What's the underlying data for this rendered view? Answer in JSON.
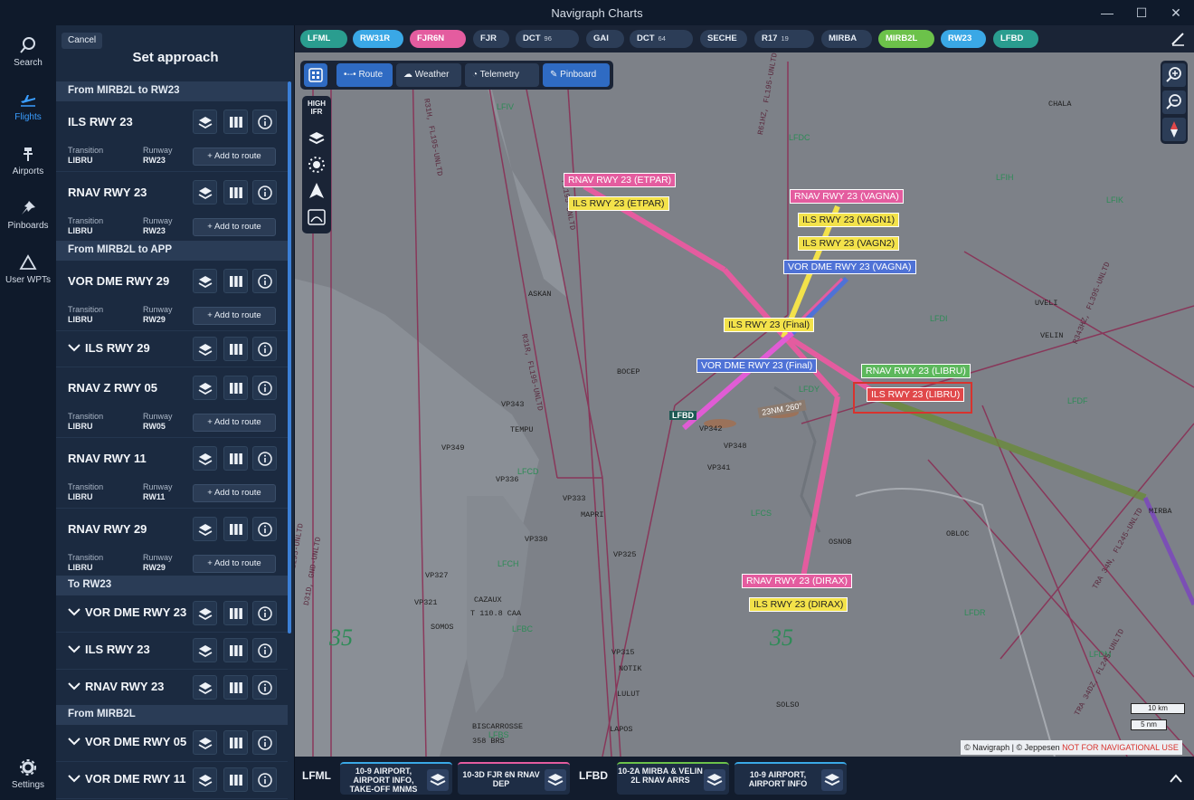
{
  "window": {
    "title": "Navigraph Charts",
    "minimize": "—",
    "maximize": "☐",
    "close": "✕"
  },
  "rail": {
    "items": [
      {
        "label": "Search",
        "icon": "search-icon"
      },
      {
        "label": "Flights",
        "icon": "plane-icon",
        "active": true
      },
      {
        "label": "Airports",
        "icon": "tower-icon"
      },
      {
        "label": "Pinboards",
        "icon": "pin-icon"
      },
      {
        "label": "User WPTs",
        "icon": "triangle-icon"
      }
    ],
    "settings": "Settings"
  },
  "panel": {
    "cancel": "Cancel",
    "title": "Set approach",
    "transition_label": "Transition",
    "runway_label": "Runway",
    "add_label": "+ Add to route",
    "sections": [
      {
        "title": "From MIRB2L to RW23"
      },
      {
        "title": "From MIRB2L to APP"
      },
      {
        "title": "To RW23"
      },
      {
        "title": "From MIRB2L"
      }
    ],
    "rows": [
      {
        "name": "ILS RWY 23",
        "transition": "LIBRU",
        "runway": "RW23"
      },
      {
        "name": "RNAV RWY 23",
        "transition": "LIBRU",
        "runway": "RW23"
      },
      {
        "name": "VOR DME RWY 29",
        "transition": "LIBRU",
        "runway": "RW29"
      },
      {
        "name": "ILS RWY 29"
      },
      {
        "name": "RNAV Z RWY 05",
        "transition": "LIBRU",
        "runway": "RW05"
      },
      {
        "name": "RNAV RWY 11",
        "transition": "LIBRU",
        "runway": "RW11"
      },
      {
        "name": "RNAV RWY 29",
        "transition": "LIBRU",
        "runway": "RW29"
      },
      {
        "name": "VOR DME RWY 23"
      },
      {
        "name": "ILS RWY 23"
      },
      {
        "name": "RNAV RWY 23"
      },
      {
        "name": "VOR DME RWY 05"
      },
      {
        "name": "VOR DME RWY 11"
      }
    ]
  },
  "route_chips": [
    {
      "label": "LFML",
      "bg": "#2a9d8f",
      "fg": "#ffffff"
    },
    {
      "label": "RW31R",
      "bg": "#3aa8e6",
      "fg": "#ffffff"
    },
    {
      "label": "FJR6N",
      "bg": "#e45c9f",
      "fg": "#ffffff"
    },
    {
      "label": "FJR",
      "bg": "#2c3d57",
      "fg": "#e8eef6"
    },
    {
      "label": "DCT",
      "num": "96",
      "bg": "#2c3d57",
      "fg": "#e8eef6"
    },
    {
      "label": "GAI",
      "bg": "#2c3d57",
      "fg": "#e8eef6"
    },
    {
      "label": "DCT",
      "num": "64",
      "bg": "#2c3d57",
      "fg": "#e8eef6"
    },
    {
      "label": "SECHE",
      "bg": "#2c3d57",
      "fg": "#e8eef6"
    },
    {
      "label": "R17",
      "num": "19",
      "bg": "#2c3d57",
      "fg": "#e8eef6"
    },
    {
      "label": "MIRBA",
      "bg": "#2c3d57",
      "fg": "#e8eef6"
    },
    {
      "label": "MIRB2L",
      "bg": "#6cc24a",
      "fg": "#ffffff"
    },
    {
      "label": "RW23",
      "bg": "#3aa8e6",
      "fg": "#ffffff"
    },
    {
      "label": "LFBD",
      "bg": "#2a9d8f",
      "fg": "#ffffff"
    }
  ],
  "toolbar": {
    "route": "Route",
    "weather": "Weather",
    "telemetry": "Telemetry",
    "pinboard": "Pinboard"
  },
  "vtools": {
    "high_ifr": "HIGH IFR"
  },
  "map": {
    "procedure_labels": [
      {
        "text": "RNAV RWY 23 (ETPAR)",
        "bg": "#e45c9f",
        "fg": "#ffffff"
      },
      {
        "text": "ILS RWY 23 (ETPAR)",
        "bg": "#f3e24a",
        "fg": "#222222"
      },
      {
        "text": "RNAV RWY 23 (VAGNA)",
        "bg": "#e45c9f",
        "fg": "#ffffff"
      },
      {
        "text": "ILS RWY 23 (VAGN1)",
        "bg": "#f3e24a",
        "fg": "#222222"
      },
      {
        "text": "ILS RWY 23 (VAGN2)",
        "bg": "#f3e24a",
        "fg": "#222222"
      },
      {
        "text": "VOR DME RWY 23 (VAGNA)",
        "bg": "#4f72d6",
        "fg": "#ffffff"
      },
      {
        "text": "ILS RWY 23 (Final)",
        "bg": "#f3e24a",
        "fg": "#222222"
      },
      {
        "text": "VOR DME RWY 23 (Final)",
        "bg": "#4f72d6",
        "fg": "#ffffff"
      },
      {
        "text": "RNAV RWY 23 (LIBRU)",
        "bg": "#5cb85c",
        "fg": "#ffffff"
      },
      {
        "text": "ILS RWY 23 (LIBRU)",
        "bg": "#e0484a",
        "fg": "#ffffff"
      },
      {
        "text": "RNAV RWY 23 (DIRAX)",
        "bg": "#e45c9f",
        "fg": "#ffffff"
      },
      {
        "text": "ILS RWY 23 (DIRAX)",
        "bg": "#f3e24a",
        "fg": "#222222"
      }
    ],
    "waypoints": [
      "CHALA",
      "UVELI",
      "VELIN",
      "ASKAN",
      "BOCEP",
      "VP343",
      "TEMPU",
      "VP342",
      "VP348",
      "VP341",
      "VP349",
      "VP336",
      "VP333",
      "MAPRI",
      "VP330",
      "VP325",
      "OSNOB",
      "OBLOC",
      "VP327",
      "VP321",
      "SOMOS",
      "CAZAUX",
      "T 110.8 CAA",
      "VP315",
      "NOTIK",
      "LULUT",
      "BISCARROSSE",
      "358 BRS",
      "LAPOS",
      "SOLSO",
      "MIRBA"
    ],
    "airports": [
      "LFIV",
      "LFDC",
      "LFIH",
      "LFIK",
      "LFDI",
      "LFDY",
      "LFDF",
      "LFBD",
      "LFCD",
      "LFCH",
      "LFBC",
      "LFBS",
      "LFCS",
      "LFDR",
      "LFDM"
    ],
    "heading_tag": "23NM 260°",
    "mora": [
      "35",
      "35"
    ],
    "airway_labels": [
      "R31H, FL195-UNLTD",
      "R31R, FL195-UNLTD",
      "FL195-UNLTD",
      "R61HZ, FL195-UNLTD",
      "R343HZ, FL395-UNLTD",
      "D31DZ, FL195-UNLTD",
      "D31D, GND-UNLTD",
      "TRA 34N, FL245-UNLTD",
      "TRA 34DZ, FL245-UNLTD"
    ]
  },
  "attribution": {
    "text": "© Navigraph | © Jeppesen ",
    "warning": "NOT FOR NAVIGATIONAL USE"
  },
  "scale": {
    "km": "10 km",
    "nm": "5 nm"
  },
  "bottom": {
    "origin": "LFML",
    "dest": "LFBD",
    "cards": [
      {
        "text": "10-9 AIRPORT, AIRPORT INFO, TAKE-OFF MNMS",
        "accent": "#3aa8e6"
      },
      {
        "text": "10-3D FJR 6N RNAV DEP",
        "accent": "#e45c9f"
      },
      {
        "text": "10-2A MIRBA & VELIN 2L RNAV ARRS",
        "accent": "#6cc24a"
      },
      {
        "text": "10-9 AIRPORT, AIRPORT INFO",
        "accent": "#3aa8e6"
      }
    ]
  }
}
